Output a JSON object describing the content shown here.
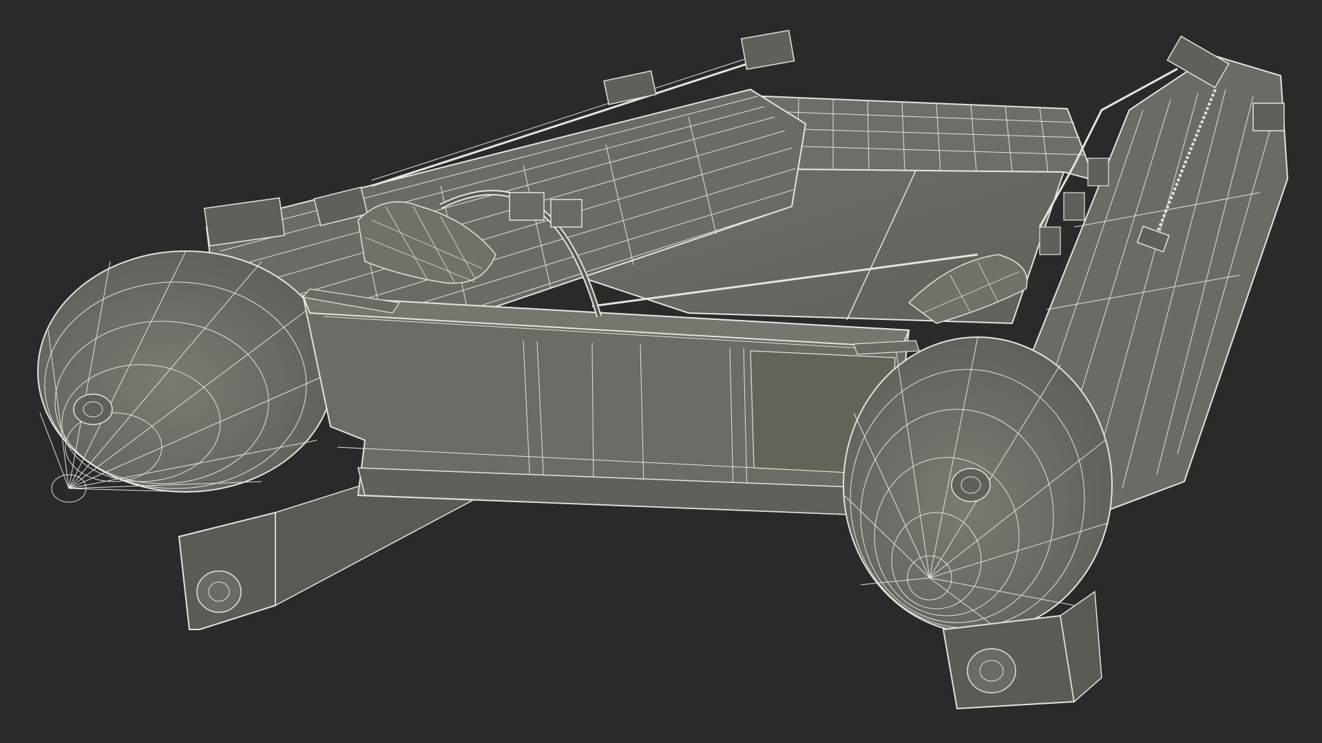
{
  "viewport": {
    "background": "#2a2a2a",
    "surface_color": "#6b6c65",
    "surface_dark": "#5a5b55",
    "wire_color": "#e4e6de"
  }
}
